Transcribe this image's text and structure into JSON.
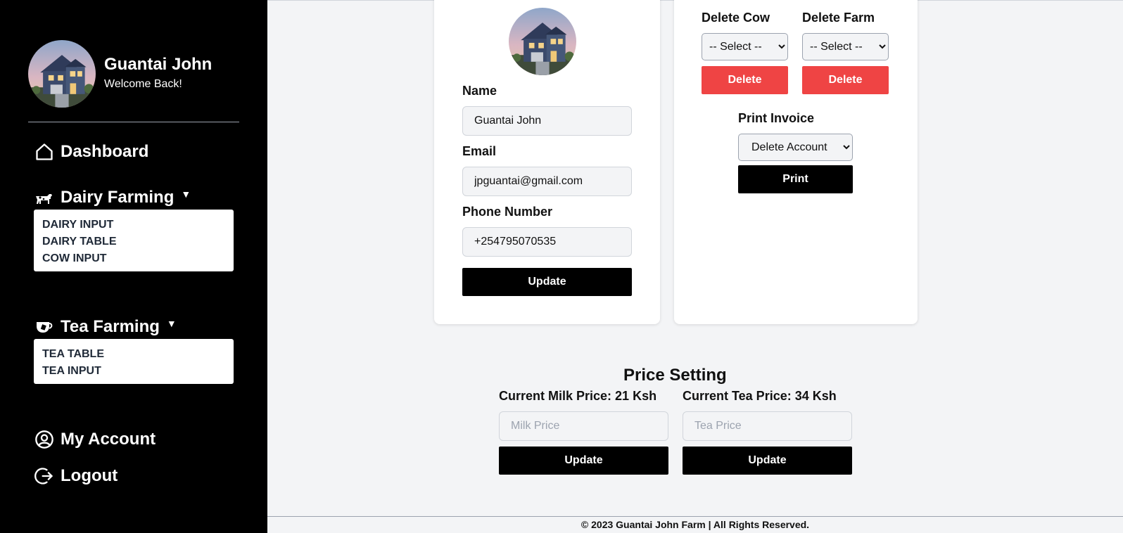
{
  "sidebar": {
    "user_name": "Guantai John",
    "welcome": "Welcome Back!",
    "dashboard": "Dashboard",
    "dairy": {
      "label": "Dairy Farming",
      "items": [
        "DAIRY INPUT",
        "DAIRY TABLE",
        "COW INPUT"
      ]
    },
    "tea": {
      "label": "Tea Farming",
      "items": [
        "TEA TABLE",
        "TEA INPUT"
      ]
    },
    "account": "My Account",
    "logout": "Logout",
    "caret": "▼"
  },
  "profile": {
    "name_label": "Name",
    "name_value": "Guantai John",
    "email_label": "Email",
    "email_value": "jpguantai@gmail.com",
    "phone_label": "Phone Number",
    "phone_value": "+254795070535",
    "update_label": "Update"
  },
  "actions": {
    "delete_cow_label": "Delete Cow",
    "delete_farm_label": "Delete Farm",
    "select_placeholder": "-- Select --",
    "delete_label": "Delete",
    "print_invoice_label": "Print Invoice",
    "print_select_value": "Delete Account",
    "print_label": "Print"
  },
  "price": {
    "title": "Price Setting",
    "milk_current": "Current Milk Price: 21 Ksh",
    "tea_current": "Current Tea Price: 34 Ksh",
    "milk_placeholder": "Milk Price",
    "tea_placeholder": "Tea Price",
    "update_label": "Update"
  },
  "footer": "© 2023 Guantai John Farm | All Rights Reserved.",
  "colors": {
    "sidebar_bg": "#000000",
    "delete_red": "#ef4444",
    "primary_btn": "#000000",
    "page_bg": "#f3f4f6"
  },
  "icons": [
    "house-avatar",
    "home-icon",
    "cow-icon",
    "tea-cup-icon",
    "user-circle-icon",
    "logout-icon"
  ]
}
